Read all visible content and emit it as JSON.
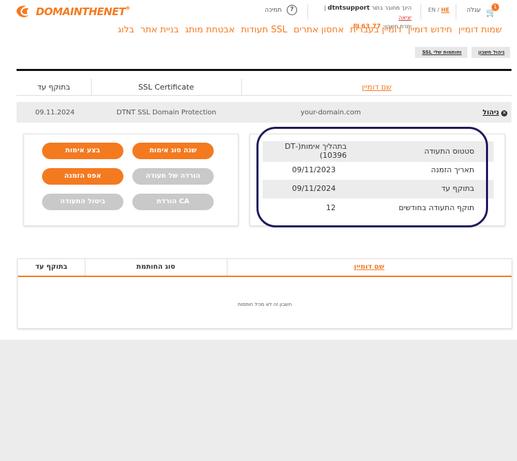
{
  "header": {
    "logo_text": "DOMAINTHENET",
    "logo_mark": "®",
    "cart_label": "עגלה",
    "cart_count": "1",
    "lang_en": "EN",
    "lang_sep": "/",
    "lang_he": "HE",
    "logged_in_prefix": "הינך מחובר בתור",
    "username": "dtntsupport",
    "logout": "יציאה",
    "balance_label": "יתרת חשבון:",
    "balance_value": "63.77 ₪",
    "support_label": "תמיכה",
    "support_icon": "?"
  },
  "nav": [
    "שמות דומיין",
    "חידוש דומיין",
    "דומיין בעברית",
    "אחסון אתרים",
    "תעודות SSL",
    "אבטחת מותג",
    "בניית אתר",
    "בלוג"
  ],
  "breadcrumb": [
    "ניהול חשבון",
    "SSL וחותמות שלי"
  ],
  "ssl_table": {
    "headers": {
      "domain": "שם דומיין",
      "cert": "SSL Certificate",
      "valid": "בתוקף עד"
    },
    "row": {
      "manage": "ניהול",
      "domain": "your-domain.com",
      "cert": "DTNT SSL Domain Protection",
      "valid": "09.11.2024"
    }
  },
  "details": [
    {
      "label": "סטטוס התעודה",
      "value": "בתהליך אימות(-DT 10396)"
    },
    {
      "label": "תאריך הזמנה",
      "value": "09/11/2023"
    },
    {
      "label": "בתוקף עד",
      "value": "09/11/2024"
    },
    {
      "label": "תוקף התעודה בחודשים",
      "value": "12"
    }
  ],
  "actions": {
    "change_validation": "שנה סוג אימות",
    "do_validation": "בצע אימות",
    "download_cert": "הורדה של תעודה",
    "reset_order": "אפס הזמנה",
    "download_ca": "הורדת CA",
    "cancel_cert": "ביטול התעודה"
  },
  "seals_table": {
    "headers": {
      "domain": "שם דומיין",
      "seal_type": "סוג החותמת",
      "valid": "בתוקף עד"
    },
    "empty_message": "חשבון זה לא מכיל חותמות"
  },
  "colors": {
    "accent": "#f47a20",
    "highlight_oval": "#1e1a5e",
    "disabled": "#c9c9c9"
  }
}
